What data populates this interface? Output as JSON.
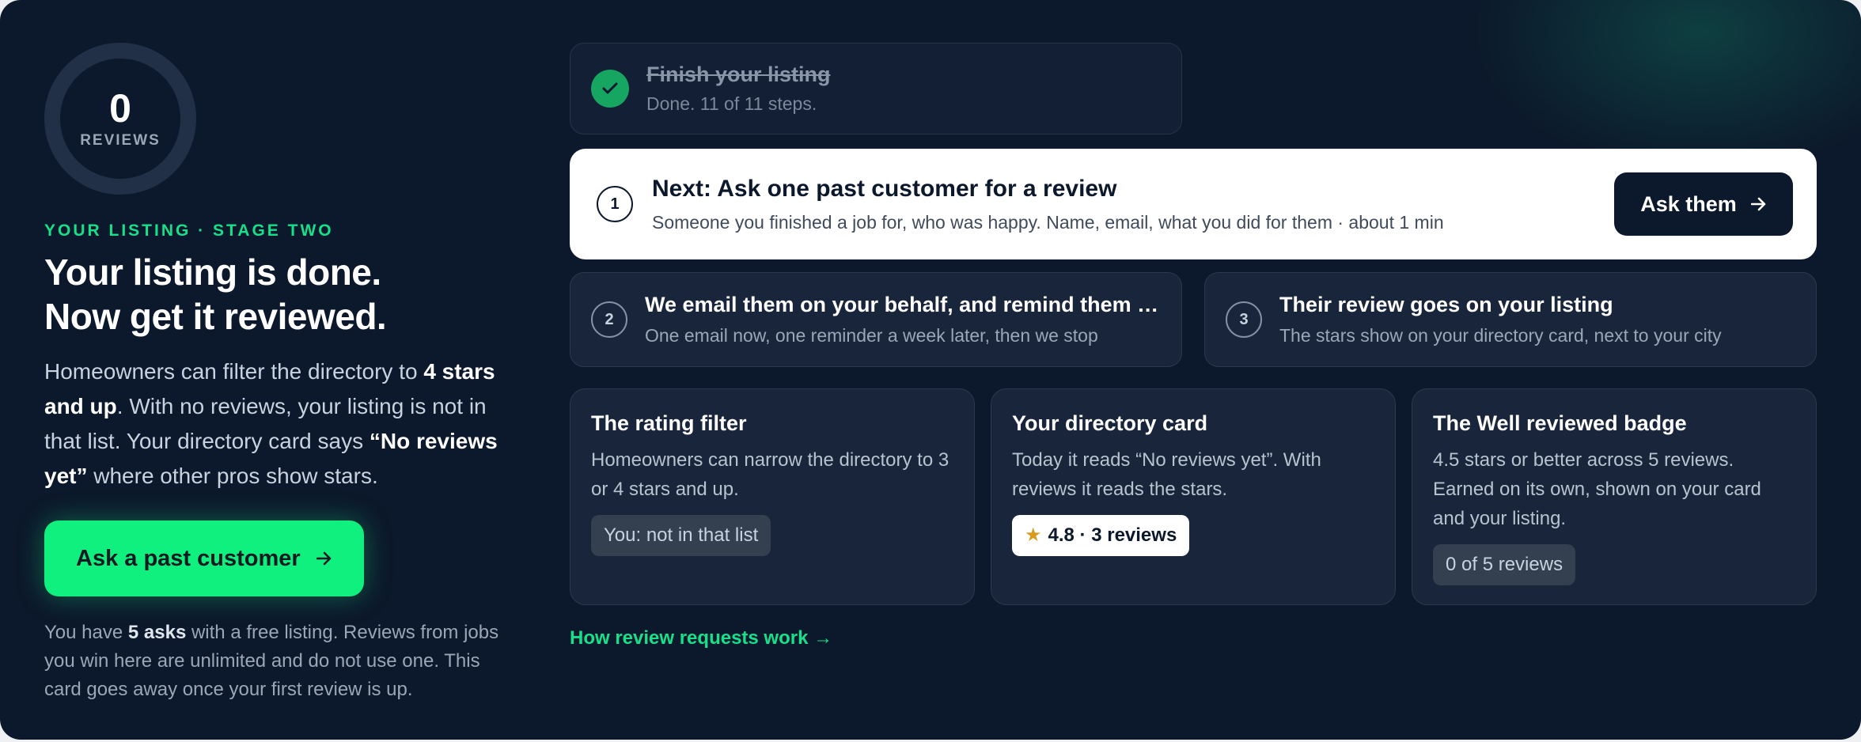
{
  "score": {
    "value": "0",
    "label": "REVIEWS"
  },
  "left": {
    "eyebrow": "YOUR LISTING · STAGE TWO",
    "headline_line1": "Your listing is done.",
    "headline_line2": "Now get it reviewed.",
    "lead_1": "Homeowners can filter the directory to ",
    "lead_bold_1": "4 stars and up",
    "lead_2": ". With no reviews, your listing is not in that list. Your directory card says ",
    "lead_bold_2": "“No reviews yet”",
    "lead_3": " where other pros show stars.",
    "cta_label": "Ask a past customer",
    "footnote_1": "You have ",
    "footnote_bold": "5 asks",
    "footnote_2": " with a free listing. Reviews from jobs you win here are unlimited and do not use one. This card goes away once your first review is up."
  },
  "steps": {
    "done": {
      "title": "Finish your listing",
      "subtitle": "Done. 11 of 11 steps."
    },
    "next": {
      "number": "1",
      "title": "Next: Ask one past customer for a review",
      "subtitle": "Someone you finished a job for, who was happy. Name, email, what you did for them · about 1 min",
      "button_label": "Ask them"
    },
    "step2": {
      "number": "2",
      "title": "We email them on your behalf, and remind them once",
      "subtitle": "One email now, one reminder a week later, then we stop"
    },
    "step3": {
      "number": "3",
      "title": "Their review goes on your listing",
      "subtitle": "The stars show on your directory card, next to your city"
    }
  },
  "info_cards": [
    {
      "title": "The rating filter",
      "body": "Homeowners can narrow the directory to 3 or 4 stars and up.",
      "pill": "You: not in that list"
    },
    {
      "title": "Your directory card",
      "body": "Today it reads “No reviews yet”. With reviews it reads the stars.",
      "pill_star": "★",
      "pill": "4.8 · 3 reviews"
    },
    {
      "title": "The Well reviewed badge",
      "body": "4.5 stars or better across 5 reviews. Earned on its own, shown on your card and your listing.",
      "pill": "0 of 5 reviews"
    }
  ],
  "how_link": "How review requests work →",
  "icons": {
    "check": "check-icon",
    "arrow": "arrow-right-icon",
    "star": "star-icon"
  },
  "colors": {
    "accent": "#10f07e",
    "background": "#0c182b",
    "check": "#17a562",
    "star": "#d79b1e"
  }
}
